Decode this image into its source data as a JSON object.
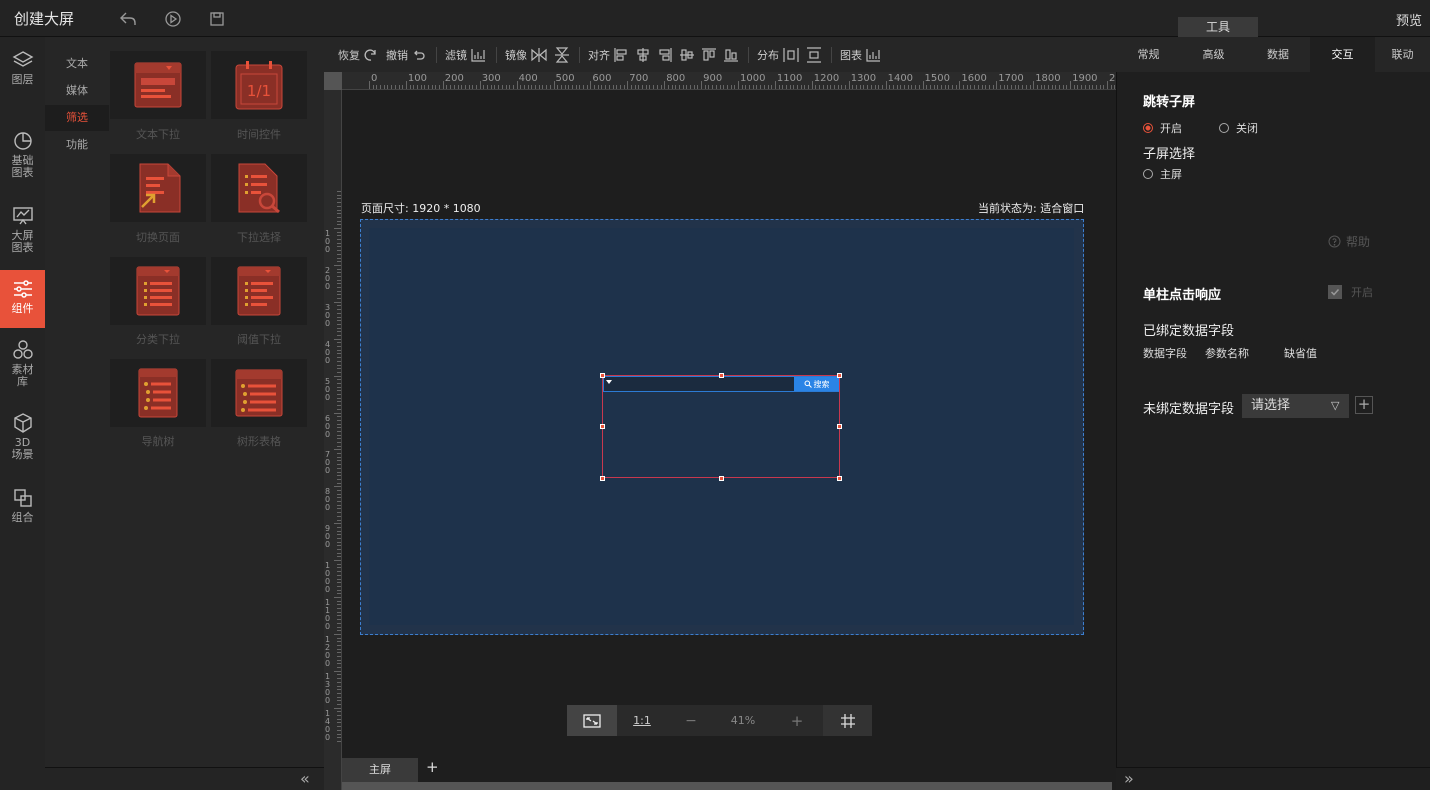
{
  "header": {
    "title": "创建大屏",
    "preview_label": "预览",
    "tool_tab": "工具"
  },
  "leftnav": {
    "items": [
      {
        "label": "图层",
        "icon": "layers-icon"
      },
      {
        "label": "基础图表",
        "icon": "pie-chart-icon"
      },
      {
        "label": "大屏图表",
        "icon": "monitor-chart-icon"
      },
      {
        "label": "组件",
        "icon": "sliders-icon",
        "active": true
      },
      {
        "label": "素材库",
        "icon": "material-icon"
      },
      {
        "label": "3D场景",
        "icon": "cube-icon"
      },
      {
        "label": "组合",
        "icon": "group-icon"
      }
    ]
  },
  "subnav": {
    "items": [
      {
        "label": "文本"
      },
      {
        "label": "媒体"
      },
      {
        "label": "筛选",
        "active": true
      },
      {
        "label": "功能"
      }
    ]
  },
  "gallery": {
    "tiles": [
      {
        "label": "文本下拉"
      },
      {
        "label": "时间控件"
      },
      {
        "label": "切换页面"
      },
      {
        "label": "下拉选择"
      },
      {
        "label": "分类下拉"
      },
      {
        "label": "阈值下拉"
      },
      {
        "label": "导航树"
      },
      {
        "label": "树形表格"
      }
    ],
    "time_glyph": "1/1"
  },
  "toolbar": {
    "redo": "恢复",
    "undo": "撤销",
    "filter": "滤镜",
    "mirror": "镜像",
    "align": "对齐",
    "distribute": "分布",
    "chart": "图表"
  },
  "ruler": {
    "h_labels": [
      "0",
      "100",
      "200",
      "300",
      "400",
      "500",
      "600",
      "700",
      "800",
      "900",
      "1000",
      "1100",
      "1200",
      "1300",
      "1400",
      "1500",
      "1600",
      "1700",
      "1800",
      "1900",
      "20"
    ],
    "v_labels": [
      "100",
      "200",
      "300",
      "400",
      "500",
      "600",
      "700",
      "800",
      "900",
      "1000",
      "1100",
      "1200",
      "1300",
      "1400"
    ]
  },
  "canvas": {
    "page_size": "页面尺寸: 1920 * 1080",
    "state": "当前状态为: 适合窗口",
    "search_button": "搜索"
  },
  "zoom": {
    "fit_label": "1:1",
    "minus": "−",
    "level": "41%",
    "plus": "+"
  },
  "screens": {
    "main_tab": "主屏",
    "add": "+"
  },
  "right": {
    "tabs": [
      "常规",
      "高级",
      "数据",
      "交互",
      "联动"
    ],
    "jump_title": "跳转子屏",
    "on_label": "开启",
    "off_label": "关闭",
    "sub_select_title": "子屏选择",
    "main_screen": "主屏",
    "help": "帮助",
    "single_click_title": "单柱点击响应",
    "single_click_on": "开启",
    "bound_title": "已绑定数据字段",
    "col_field": "数据字段",
    "col_param": "参数名称",
    "col_default": "缺省值",
    "unbound_title": "未绑定数据字段",
    "select_placeholder": "请选择"
  },
  "colors": {
    "accent": "#e8523a",
    "canvas": "#1e324b",
    "primary": "#2a84e6"
  }
}
